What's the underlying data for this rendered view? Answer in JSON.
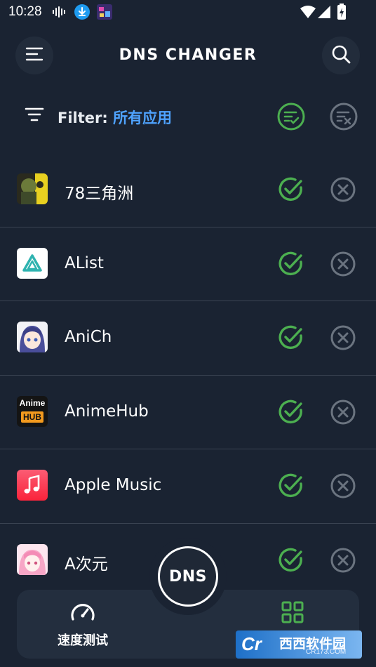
{
  "status_bar": {
    "time": "10:28",
    "icons": [
      "audio-wave-icon",
      "download-icon",
      "game-app-icon",
      "wifi-icon",
      "signal-icon",
      "battery-icon"
    ]
  },
  "header": {
    "title": "DNS CHANGER",
    "menu_icon": "menu-icon",
    "search_icon": "search-icon"
  },
  "filter": {
    "label": "Filter:",
    "value": "所有应用",
    "allow_all_icon": "allow-all-icon",
    "block_all_icon": "block-all-icon"
  },
  "apps": [
    {
      "name": "78三角洲",
      "icon": "app-icon-78sanjiaozhou"
    },
    {
      "name": "AList",
      "icon": "app-icon-alist"
    },
    {
      "name": "AniCh",
      "icon": "app-icon-anich"
    },
    {
      "name": "AnimeHub",
      "icon": "app-icon-animehub",
      "icon_text_top": "Anime",
      "icon_text_bottom": "HUB"
    },
    {
      "name": "Apple Music",
      "icon": "app-icon-apple-music"
    },
    {
      "name": "A次元",
      "icon": "app-icon-aciyuan"
    }
  ],
  "bottom_nav": {
    "speed_test_label": "速度测试",
    "speed_test_icon": "speedometer-icon",
    "apps_icon": "grid-icon",
    "fab_label": "DNS"
  },
  "colors": {
    "background": "#1a2332",
    "accent_blue": "#4fa3ff",
    "allow_green": "#4caf50",
    "block_gray": "#6b7480"
  },
  "watermark": {
    "logo": "Cr",
    "text": "西西软件园",
    "sub": "CR173.COM"
  }
}
